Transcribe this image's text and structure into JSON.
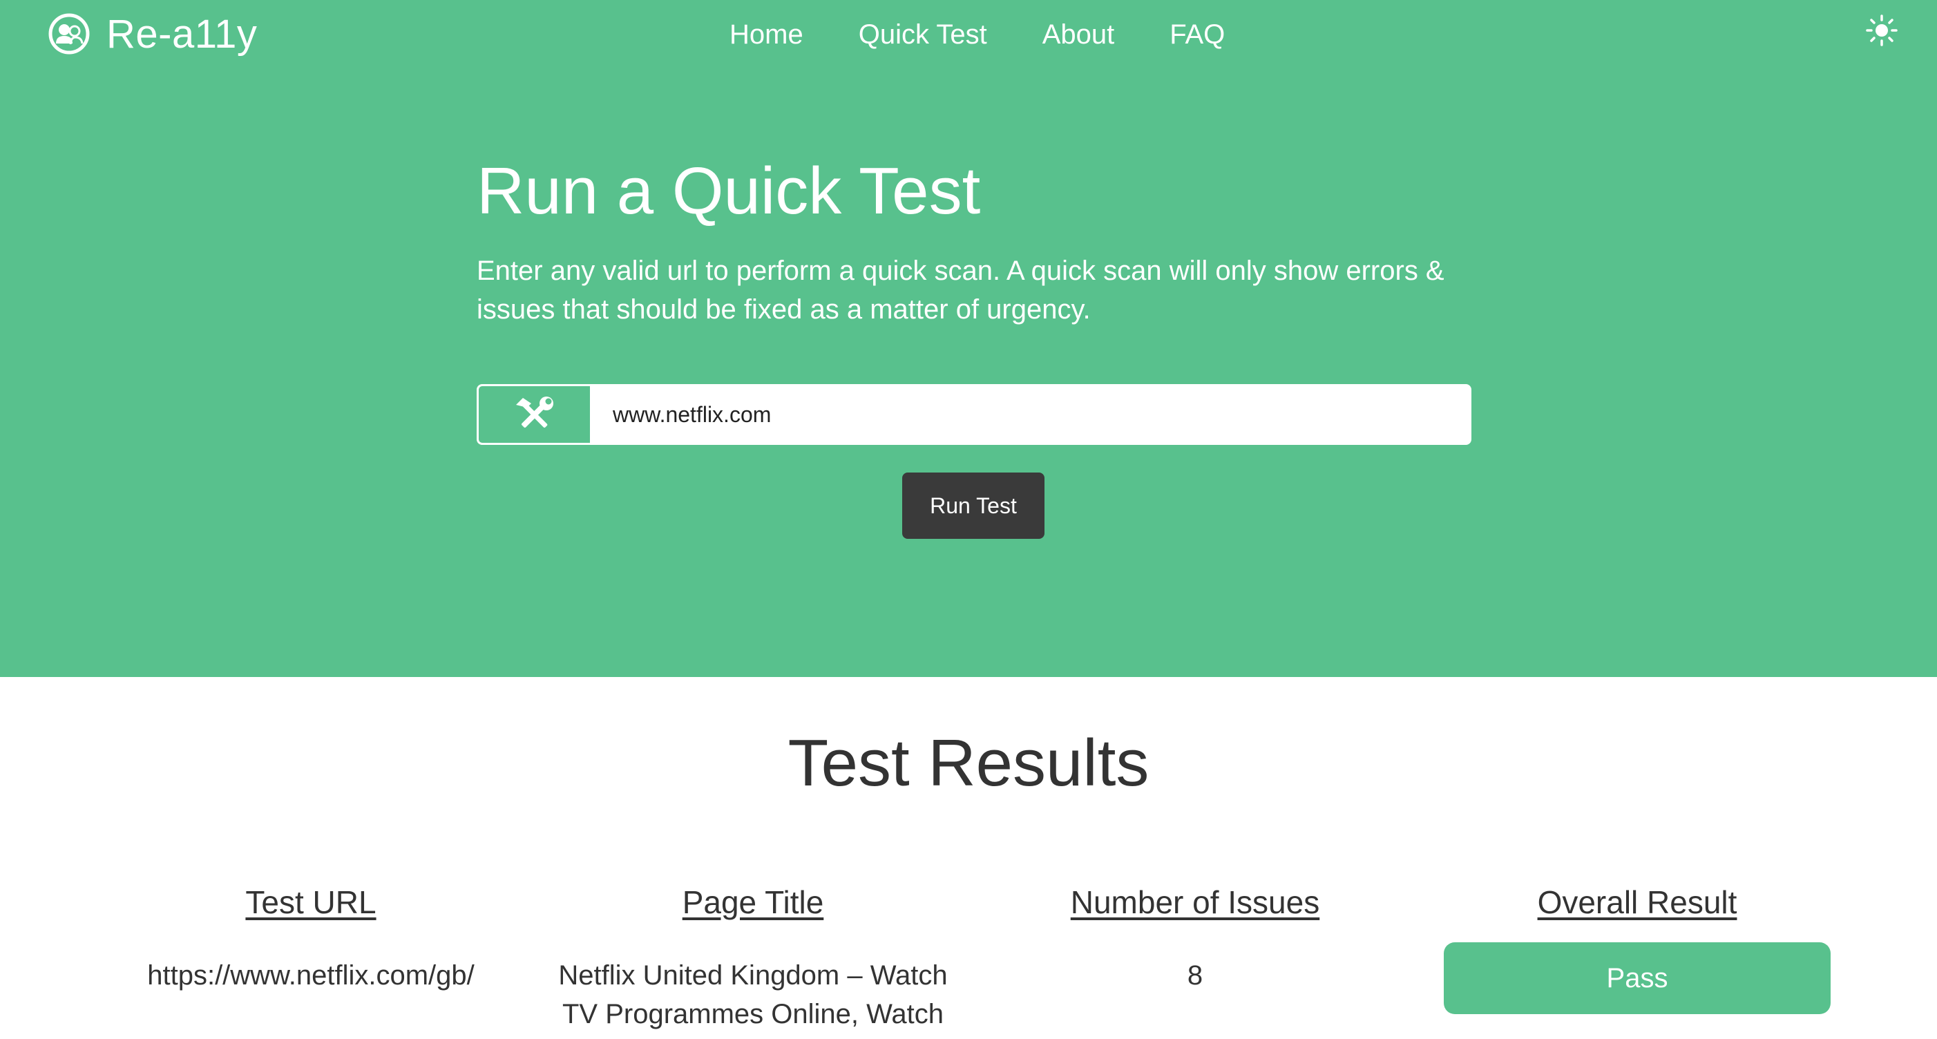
{
  "brand": {
    "name": "Re-a11y",
    "logo_icon": "users-circle-icon"
  },
  "nav": {
    "items": [
      {
        "label": "Home"
      },
      {
        "label": "Quick Test"
      },
      {
        "label": "About"
      },
      {
        "label": "FAQ"
      }
    ],
    "theme_icon": "sun-icon"
  },
  "hero": {
    "title": "Run a Quick Test",
    "description": "Enter any valid url to perform a quick scan. A quick scan will only show errors & issues that should be fixed as a matter of urgency.",
    "input_icon": "tools-icon",
    "url_value": "www.netflix.com",
    "run_button": "Run Test"
  },
  "results": {
    "title": "Test Results",
    "headers": {
      "test_url": "Test URL",
      "page_title": "Page Title",
      "issues": "Number of Issues",
      "result": "Overall Result"
    },
    "row": {
      "test_url": "https://www.netflix.com/gb/",
      "page_title": "Netflix United Kingdom – Watch TV Programmes Online, Watch",
      "issues": "8",
      "result": "Pass"
    }
  },
  "colors": {
    "accent": "#58c18d",
    "button_dark": "#3a3a3a",
    "text_dark": "#333333"
  }
}
